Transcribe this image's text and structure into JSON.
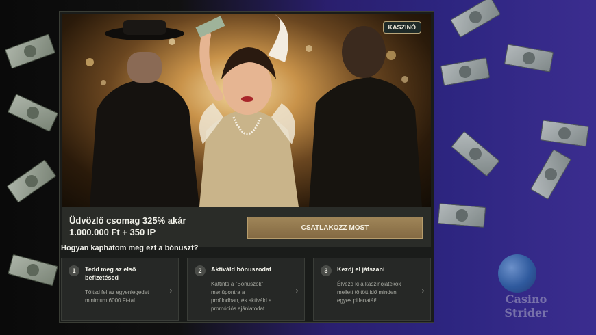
{
  "hero": {
    "badge": "KASZINÓ"
  },
  "promo": {
    "line1": "Üdvözlő csomag 325% akár",
    "line2": "1.000.000 Ft + 350 IP",
    "cta_label": "CSATLAKOZZ MOST"
  },
  "howto": {
    "title": "Hogyan kaphatom meg ezt a bónuszt?",
    "steps": [
      {
        "number": "1",
        "title_line1": "Tedd meg az első",
        "title_line2": "befizetésed",
        "desc_line1": "Töltsd fel az egyenlegedet",
        "desc_line2": "minimum 6000 Ft-tal",
        "desc_line3": "",
        "desc_line4": ""
      },
      {
        "number": "2",
        "title_line1": "Aktiváld bónuszodat",
        "title_line2": "",
        "desc_line1": "Kattints a \"Bónuszok\"",
        "desc_line2": "menüpontra a",
        "desc_line3": "profilodban, és aktiváld a",
        "desc_line4": "promóciós ajánlatodat"
      },
      {
        "number": "3",
        "title_line1": "Kezdj el játszani",
        "title_line2": "",
        "desc_line1": "Élvezd ki a kaszinójátékok",
        "desc_line2": "mellett töltött idő minden",
        "desc_line3": "egyes pillanatát!",
        "desc_line4": ""
      }
    ]
  },
  "watermark": {
    "line1": "Casino",
    "line2": "Strider"
  },
  "icons": {
    "chevron": "chevron-right-icon"
  },
  "colors": {
    "cta_gold": "#9f8558",
    "panel_bg": "#1a1c1a",
    "badge_bg": "#1e2a28"
  }
}
